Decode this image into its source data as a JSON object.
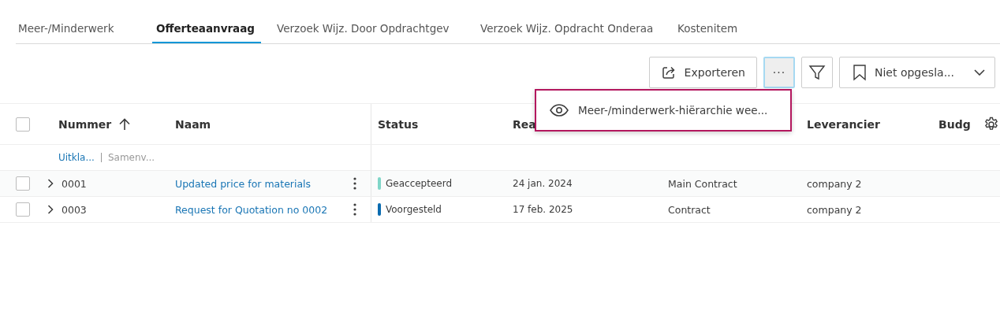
{
  "tabs": [
    {
      "label": "Meer-/Minderwerk",
      "selected": false
    },
    {
      "label": "Offerteaanvraag",
      "selected": true
    },
    {
      "label": "Verzoek Wijz. Door Opdrachtgev",
      "selected": false
    },
    {
      "label": "Verzoek Wijz. Opdracht Onderaa",
      "selected": false
    },
    {
      "label": "Kostenitem",
      "selected": false
    }
  ],
  "toolbar": {
    "export_button": "Exporteren",
    "more_button": "···",
    "view_select": "Niet opgesla..."
  },
  "menu": {
    "items": [
      {
        "label": "Meer-/minderwerk-hiërarchie wee..."
      }
    ]
  },
  "table": {
    "select_all_checked": false,
    "columns": [
      "Nummer",
      "Naam",
      "Status",
      "Rea",
      "Leverancier",
      "Budg"
    ],
    "filter_row": {
      "expand": "Uitkla...",
      "collapse": "Samenv..."
    },
    "rows": [
      {
        "checked": false,
        "number": "0001",
        "name": "Updated price for materials",
        "status": "Geaccepteerd",
        "color": "#7fd6c8",
        "date": "24 jan. 2024",
        "contract": "Main Contract",
        "supplier": "company 2"
      },
      {
        "checked": false,
        "number": "0003",
        "name": "Request for Quotation no 0002",
        "status": "Voorgesteld",
        "color": "#0a6bb0",
        "date": "17 feb. 2025",
        "contract": "Contract",
        "supplier": "company 2"
      }
    ]
  }
}
